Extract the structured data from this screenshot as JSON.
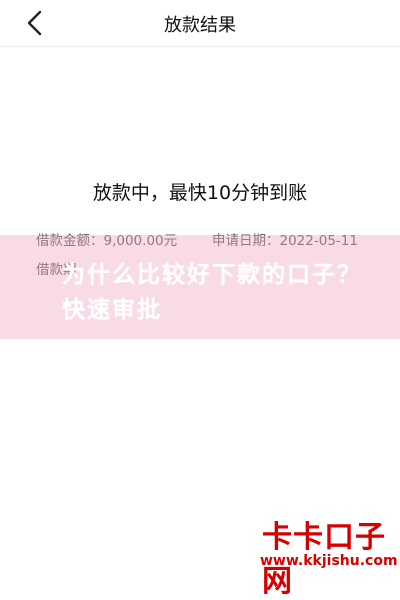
{
  "header": {
    "title": "放款结果",
    "back_icon": "chevron-left-icon"
  },
  "status": {
    "text": "放款中，最快10分钟到账"
  },
  "details": {
    "amount": "借款金额：9,000.00元",
    "apply_date": "申请日期：2022-05-11",
    "term_partial": "借款期"
  },
  "overlay": {
    "banner_text": "为什么比较好下款的口子？快速审批"
  },
  "watermark": {
    "title": "卡卡口子网",
    "url": "www.kkjishu.com"
  },
  "colors": {
    "accent": "#d60000",
    "banner": "#eeaac3"
  }
}
